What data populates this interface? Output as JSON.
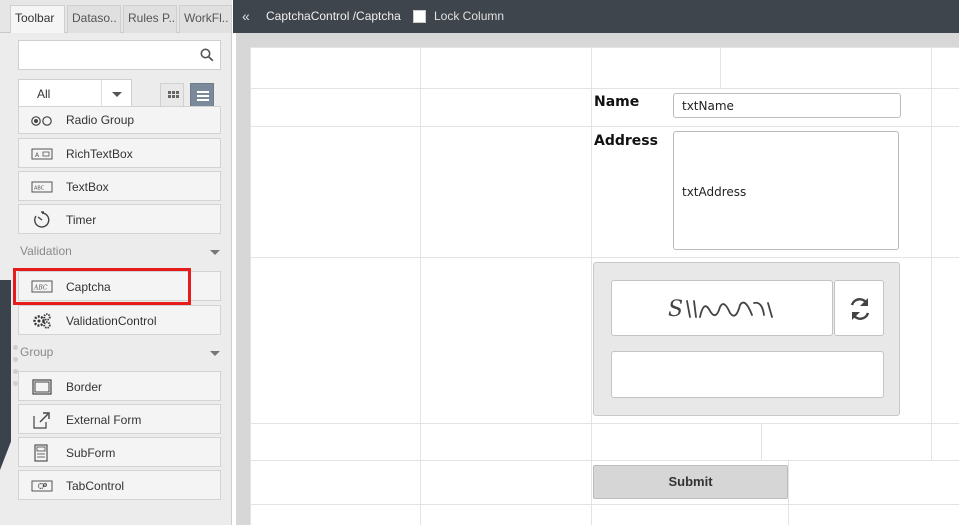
{
  "left_panel": {
    "tabs": [
      {
        "label": "Toolbar"
      },
      {
        "label": "Dataso.."
      },
      {
        "label": "Rules P.."
      },
      {
        "label": "WorkFl.."
      }
    ],
    "search": {
      "value": "",
      "placeholder": ""
    },
    "filter": {
      "selected": "All"
    },
    "items": [
      {
        "label": "Radio Group",
        "icon": "radio-group-icon"
      },
      {
        "label": "RichTextBox",
        "icon": "richtextbox-icon"
      },
      {
        "label": "TextBox",
        "icon": "textbox-icon"
      },
      {
        "label": "Timer",
        "icon": "timer-icon"
      }
    ],
    "sections": [
      {
        "label": "Validation"
      },
      {
        "label": "Group"
      }
    ],
    "validation_items": [
      {
        "label": "Captcha",
        "icon": "captcha-icon"
      },
      {
        "label": "ValidationControl",
        "icon": "gears-icon"
      }
    ],
    "group_items": [
      {
        "label": "Border",
        "icon": "border-icon"
      },
      {
        "label": "External Form",
        "icon": "external-form-icon"
      },
      {
        "label": "SubForm",
        "icon": "subform-icon"
      },
      {
        "label": "TabControl",
        "icon": "tabcontrol-icon"
      }
    ]
  },
  "top_bar": {
    "back_icon": "double-chevron-left-icon",
    "path": "CaptchaControl /Captcha",
    "lock_label": "Lock Column",
    "lock_checked": false
  },
  "form": {
    "name_label": "Name",
    "name_value": "txtName",
    "address_label": "Address",
    "address_value": "txtAddress",
    "captcha": {
      "refresh_icon": "refresh-icon",
      "input_value": ""
    },
    "submit_label": "Submit"
  },
  "colors": {
    "highlight": "#e61c1c",
    "top_bar": "#3f454d",
    "side_handle": "#3a424c"
  }
}
